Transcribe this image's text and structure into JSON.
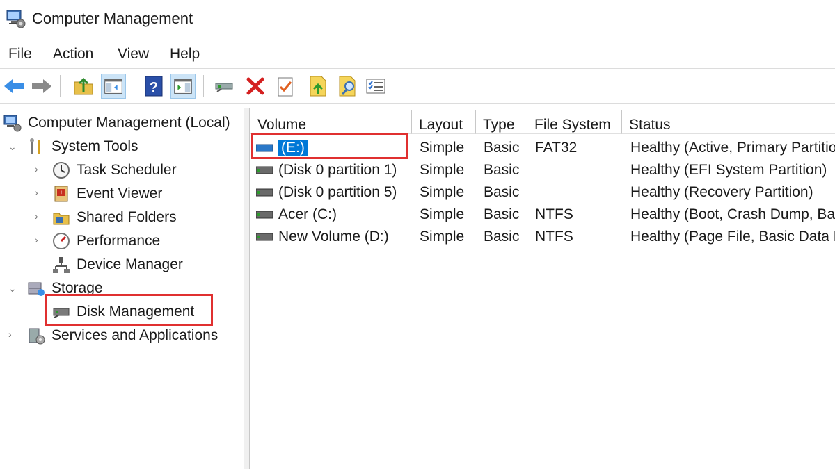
{
  "window": {
    "title": "Computer Management"
  },
  "menu": [
    "File",
    "Action",
    "View",
    "Help"
  ],
  "toolbar": {
    "icons": [
      "back-arrow-icon",
      "forward-arrow-icon",
      "up-folder-icon",
      "show-hide-tree-icon",
      "help-icon",
      "show-hide-action-pane-icon",
      "connect-icon",
      "delete-icon",
      "properties-icon",
      "import-icon",
      "search-icon",
      "settings-list-icon"
    ]
  },
  "tree": {
    "root": "Computer Management (Local)",
    "system_tools": "System Tools",
    "task_scheduler": "Task Scheduler",
    "event_viewer": "Event Viewer",
    "shared_folders": "Shared Folders",
    "performance": "Performance",
    "device_manager": "Device Manager",
    "storage": "Storage",
    "disk_management": "Disk Management",
    "services": "Services and Applications"
  },
  "table": {
    "columns": [
      "Volume",
      "Layout",
      "Type",
      "File System",
      "Status"
    ],
    "rows": [
      {
        "volume": "(E:)",
        "layout": "Simple",
        "type": "Basic",
        "fs": "FAT32",
        "status": "Healthy (Active, Primary Partition)"
      },
      {
        "volume": "(Disk 0 partition 1)",
        "layout": "Simple",
        "type": "Basic",
        "fs": "",
        "status": "Healthy (EFI System Partition)"
      },
      {
        "volume": "(Disk 0 partition 5)",
        "layout": "Simple",
        "type": "Basic",
        "fs": "",
        "status": "Healthy (Recovery Partition)"
      },
      {
        "volume": "Acer (C:)",
        "layout": "Simple",
        "type": "Basic",
        "fs": "NTFS",
        "status": "Healthy (Boot, Crash Dump, Basic Data Partition)"
      },
      {
        "volume": "New Volume (D:)",
        "layout": "Simple",
        "type": "Basic",
        "fs": "NTFS",
        "status": "Healthy (Page File, Basic Data Partition)"
      }
    ]
  },
  "colors": {
    "highlight_box": "#e03030",
    "selection": "#0078d7"
  }
}
